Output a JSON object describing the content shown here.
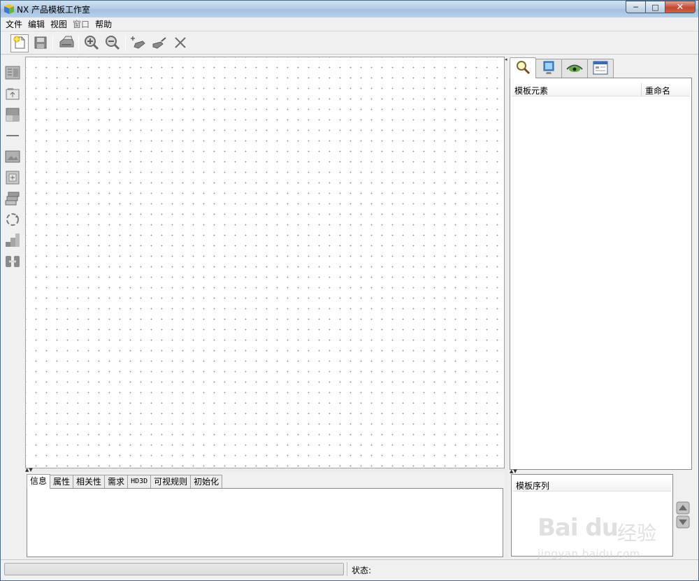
{
  "window": {
    "title": "NX 产品模板工作室",
    "minimize_glyph": "─",
    "maximize_glyph": "□",
    "close_glyph": "✕"
  },
  "menu": [
    {
      "label": "文件",
      "enabled": true
    },
    {
      "label": "编辑",
      "enabled": true
    },
    {
      "label": "视图",
      "enabled": true
    },
    {
      "label": "窗口",
      "enabled": false
    },
    {
      "label": "帮助",
      "enabled": true
    }
  ],
  "toolbar": {
    "icons": [
      "new-icon",
      "save-icon",
      "print-icon",
      "zoom-in-icon",
      "zoom-out-icon",
      "add-element-icon",
      "edit-element-icon",
      "delete-icon"
    ],
    "active": "new-icon"
  },
  "palette": {
    "icons": [
      "form-icon",
      "frame-icon",
      "layout-icon",
      "separator-icon",
      "image-icon",
      "group-icon",
      "stack-icon",
      "cycle-icon",
      "steps-icon",
      "link-icon"
    ]
  },
  "bottom_tabs": [
    {
      "label": "信息",
      "active": true,
      "mono": false
    },
    {
      "label": "属性",
      "active": false,
      "mono": false
    },
    {
      "label": "相关性",
      "active": false,
      "mono": false
    },
    {
      "label": "需求",
      "active": false,
      "mono": false
    },
    {
      "label": "HD3D",
      "active": false,
      "mono": true
    },
    {
      "label": "可视规则",
      "active": false,
      "mono": false
    },
    {
      "label": "初始化",
      "active": false,
      "mono": false
    }
  ],
  "right_tabs": [
    {
      "icon": "search-icon",
      "active": true
    },
    {
      "icon": "monitor-icon",
      "active": false
    },
    {
      "icon": "eye-icon",
      "active": false
    },
    {
      "icon": "window-icon",
      "active": false
    }
  ],
  "tree": {
    "col_element": "模板元素",
    "col_rename": "重命名"
  },
  "sequence": {
    "title": "模板序列"
  },
  "splitter_arrows": "▲▼",
  "splitter_left_arrow": "◂",
  "status": {
    "label": "状态:"
  },
  "watermark": {
    "brand": "Bai du",
    "suffix": "经验",
    "url": "jingyan.baidu.com"
  },
  "colors": {
    "titlebar": "#b6cde6",
    "close_button": "#c44a30",
    "canvas_dot": "#9a9a9a"
  }
}
